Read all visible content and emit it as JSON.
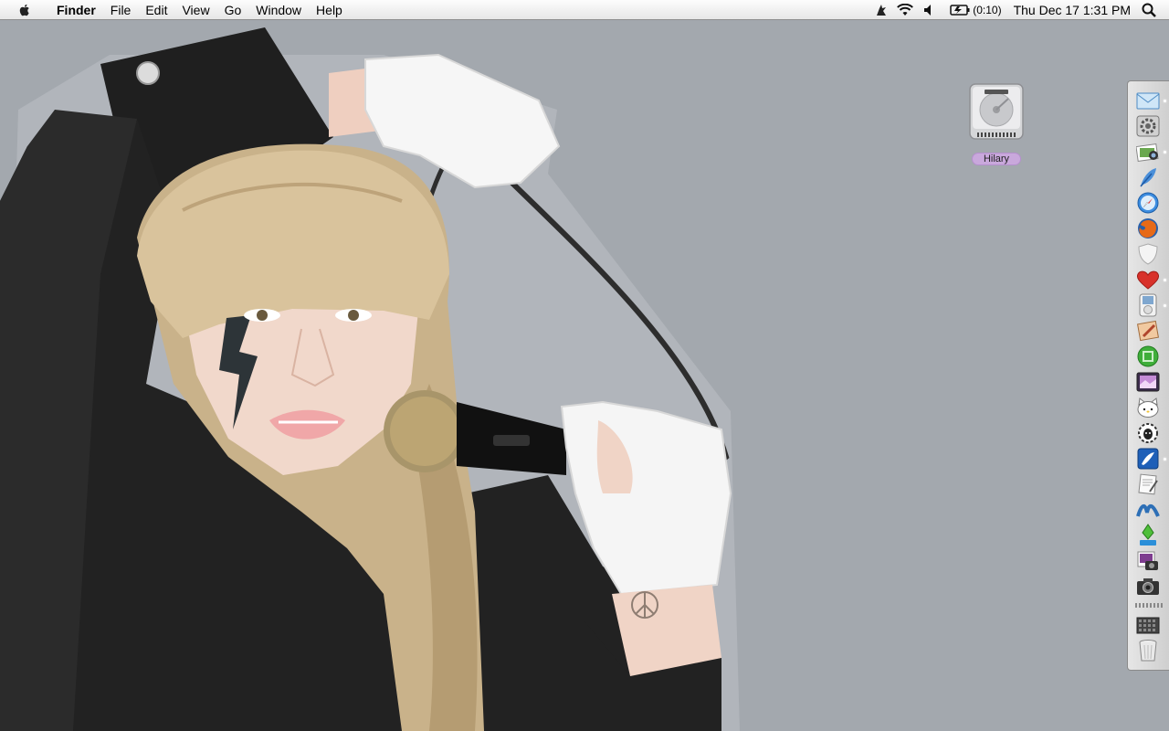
{
  "menubar": {
    "app_name": "Finder",
    "menus": [
      "File",
      "Edit",
      "View",
      "Go",
      "Window",
      "Help"
    ],
    "battery_text": "(0:10)",
    "clock": "Thu Dec 17  1:31 PM"
  },
  "desktop": {
    "drive_label": "Hilary"
  },
  "dock": {
    "items": [
      {
        "icon": "mail-icon",
        "running": true
      },
      {
        "icon": "system-preferences-icon",
        "running": false
      },
      {
        "icon": "iphoto-icon",
        "running": true
      },
      {
        "icon": "feather-app-icon",
        "running": false
      },
      {
        "icon": "safari-icon",
        "running": false
      },
      {
        "icon": "firefox-icon",
        "running": false
      },
      {
        "icon": "shield-icon",
        "running": false
      },
      {
        "icon": "heart-icon",
        "running": true
      },
      {
        "icon": "ipod-icon",
        "running": true
      },
      {
        "icon": "paint-app-icon",
        "running": false
      },
      {
        "icon": "green-circle-app-icon",
        "running": false
      },
      {
        "icon": "photo-booth-icon",
        "running": false
      },
      {
        "icon": "hello-kitty-icon",
        "running": false
      },
      {
        "icon": "sheep-icon",
        "running": false
      },
      {
        "icon": "adium-icon",
        "running": true
      },
      {
        "icon": "textedit-icon",
        "running": false
      },
      {
        "icon": "wave-app-icon",
        "running": false
      },
      {
        "icon": "sims-icon",
        "running": false
      },
      {
        "icon": "image-capture-icon",
        "running": false
      },
      {
        "icon": "camera-icon",
        "running": false
      },
      {
        "icon": "downloads-stack-icon",
        "running": false
      },
      {
        "icon": "trash-icon",
        "running": false
      }
    ]
  }
}
